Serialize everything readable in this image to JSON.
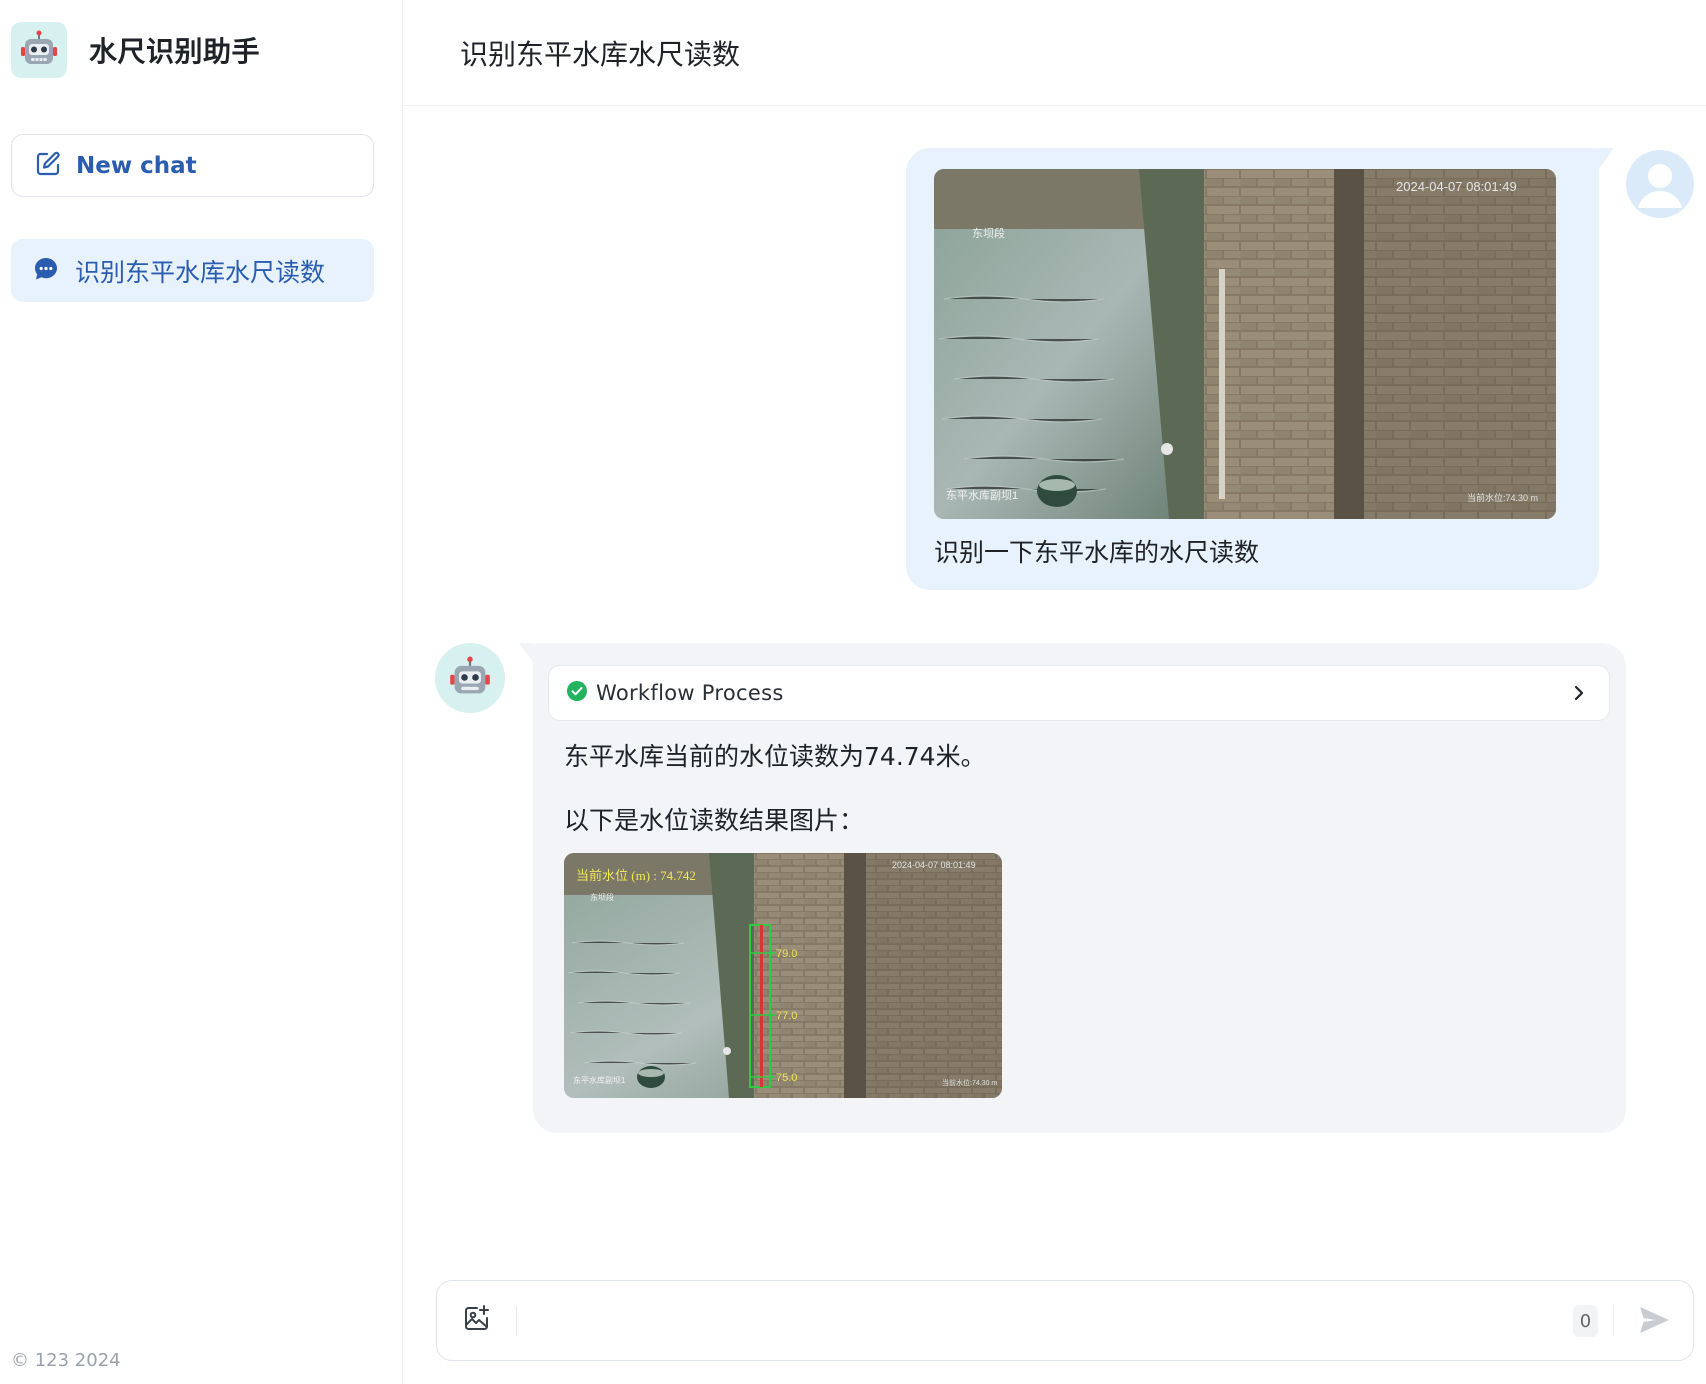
{
  "app": {
    "brand_title": "水尺识别助手",
    "new_chat_label": "New chat",
    "footer": "© 123 2024"
  },
  "sidebar": {
    "history": [
      {
        "label": "识别东平水库水尺读数",
        "active": true
      }
    ]
  },
  "header": {
    "title": "识别东平水库水尺读数"
  },
  "conversation": {
    "user_message": {
      "text": "识别一下东平水库的水尺读数",
      "image": {
        "timestamp": "2024-04-07 08:01:49",
        "caption_left": "东平水库副坝1",
        "caption_right": "当前水位:74.30 m",
        "label_top": "东坝段"
      }
    },
    "assistant_message": {
      "workflow_label": "Workflow Process",
      "workflow_status": "success",
      "text_1": "东平水库当前的水位读数为74.74米。",
      "text_2": "以下是水位读数结果图片：",
      "result_image": {
        "overlay_text": "当前水位 (m) : 74.742",
        "timestamp": "2024-04-07 08:01:49",
        "caption_left": "东平水库副坝1",
        "caption_right": "当前水位:74.30 m",
        "label_top": "东坝段",
        "scale_marks": [
          "79.0",
          "77.0",
          "75.0"
        ]
      }
    }
  },
  "composer": {
    "placeholder": "",
    "value": "",
    "char_count": "0"
  },
  "colors": {
    "accent": "#2a5db0",
    "user_bubble": "#e8f2fd",
    "bot_bubble": "#f2f4f7",
    "success": "#22b35e",
    "brand_logo_bg": "#d6f1ef"
  }
}
